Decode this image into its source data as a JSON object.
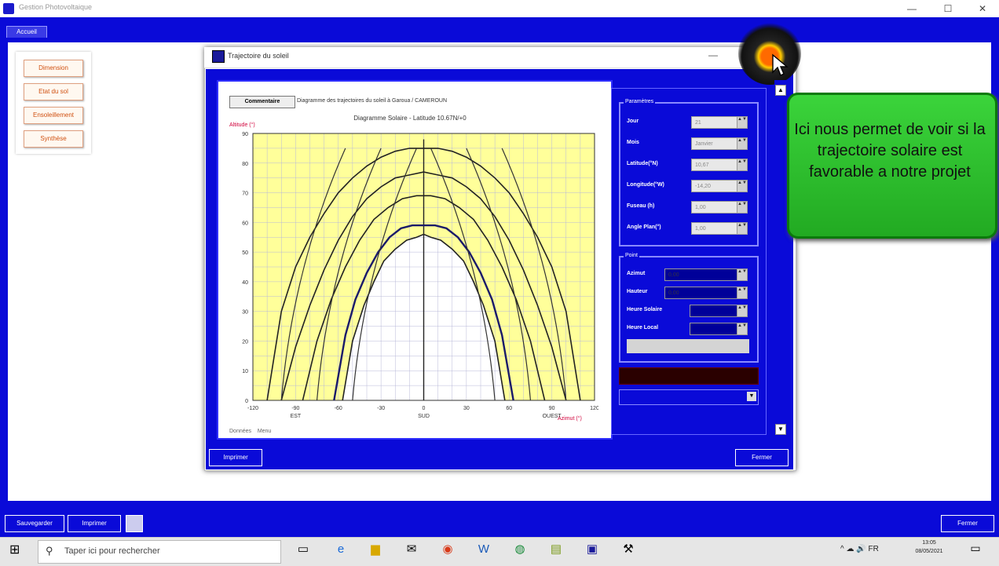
{
  "window": {
    "title": "Gestion Photovoltaique",
    "min_glyph": "—",
    "max_glyph": "☐",
    "close_glyph": "✕"
  },
  "main_tab": "Accueil",
  "sidenav": {
    "items": [
      "Dimension",
      "Etat du sol",
      "Ensoleillement",
      "Synthèse"
    ]
  },
  "dialog": {
    "title": "Trajectoire du soleil",
    "min_glyph": "—",
    "close_glyph": "✕",
    "tabs": [
      "Commentaire",
      "Diagramme des trajectoires du soleil à Garoua / CAMEROUN"
    ],
    "bottom_left_button": "Imprimer",
    "bottom_right_button": "Fermer",
    "footer_tabs": [
      "Données",
      "Menu"
    ]
  },
  "chart_data": {
    "type": "line",
    "title": "Diagramme Solaire - Latitude 10.67N/+0",
    "ylabel": "Altitude (°)",
    "xlabel": "Azimut (°)",
    "x_ticks": [
      -120,
      -90,
      -60,
      -30,
      0,
      30,
      60,
      90,
      120
    ],
    "y_ticks": [
      0,
      10,
      20,
      30,
      40,
      50,
      60,
      70,
      80,
      90
    ],
    "xlim": [
      -120,
      120
    ],
    "ylim": [
      0,
      90
    ],
    "grid": true,
    "annotations": [
      "EST",
      "SUD",
      "OUEST"
    ],
    "series": [
      {
        "x": [
          -110,
          -100,
          -90,
          -80,
          -70,
          -60,
          -50,
          -40,
          -30,
          -20,
          -10,
          0,
          10,
          20,
          30,
          40,
          50,
          60,
          70,
          80,
          90,
          100,
          110
        ],
        "y": [
          0,
          30,
          45,
          55,
          63,
          70,
          75,
          79,
          82,
          84,
          85,
          85,
          85,
          84,
          82,
          79,
          75,
          70,
          63,
          55,
          45,
          30,
          0
        ]
      },
      {
        "x": [
          -100,
          -90,
          -80,
          -70,
          -60,
          -50,
          -40,
          -30,
          -20,
          -10,
          0,
          10,
          20,
          30,
          40,
          50,
          60,
          70,
          80,
          90,
          100
        ],
        "y": [
          0,
          18,
          32,
          44,
          54,
          62,
          68,
          72,
          75,
          76,
          77,
          76,
          75,
          72,
          68,
          62,
          54,
          44,
          32,
          18,
          0
        ]
      },
      {
        "x": [
          -85,
          -75,
          -65,
          -55,
          -45,
          -35,
          -25,
          -15,
          -5,
          0,
          5,
          15,
          25,
          35,
          45,
          55,
          65,
          75,
          85
        ],
        "y": [
          0,
          20,
          34,
          45,
          54,
          61,
          65,
          68,
          69,
          69,
          69,
          68,
          65,
          61,
          54,
          45,
          34,
          20,
          0
        ]
      },
      {
        "x": [
          -63,
          -55,
          -48,
          -40,
          -32,
          -24,
          -16,
          -8,
          0,
          8,
          16,
          24,
          32,
          40,
          48,
          55,
          63
        ],
        "y": [
          0,
          22,
          34,
          43,
          50,
          55,
          58,
          59,
          59,
          59,
          58,
          55,
          50,
          43,
          34,
          22,
          0
        ]
      },
      {
        "x": [
          -57,
          -50,
          -42,
          -35,
          -28,
          -20,
          -12,
          -5,
          0,
          5,
          12,
          20,
          28,
          35,
          42,
          50,
          57
        ],
        "y": [
          0,
          20,
          32,
          40,
          47,
          51,
          54,
          55,
          56,
          55,
          54,
          51,
          47,
          40,
          32,
          20,
          0
        ]
      }
    ]
  },
  "params": {
    "group_title": "Paramètres",
    "fields": [
      {
        "label": "Jour",
        "value": "21"
      },
      {
        "label": "Mois",
        "value": "Janvier"
      },
      {
        "label": "Latitude(°N)",
        "value": "10,67"
      },
      {
        "label": "Longitude(°W)",
        "value": "-14,20"
      },
      {
        "label": "Fuseau (h)",
        "value": "1,00"
      },
      {
        "label": "Angle Plan(°)",
        "value": "1,00"
      }
    ]
  },
  "point": {
    "group_title": "Point",
    "fields": [
      {
        "label": "Azimut",
        "value": "0,00"
      },
      {
        "label": "Hauteur",
        "value": "0,00"
      },
      {
        "label": "Heure Solaire",
        "value": ""
      },
      {
        "label": "Heure Local",
        "value": ""
      }
    ]
  },
  "callout": {
    "text": "Ici nous permet de voir si la trajectoire solaire est favorable a notre projet"
  },
  "bottom_bar": {
    "left_buttons": [
      "Sauvegarder",
      "Imprimer"
    ],
    "right_button": "Fermer"
  },
  "taskbar": {
    "search_placeholder": "Taper ici pour rechercher",
    "time": "13:05",
    "date": "08/05/2021",
    "tray_text": "^ ☁ 🔊 FR"
  }
}
